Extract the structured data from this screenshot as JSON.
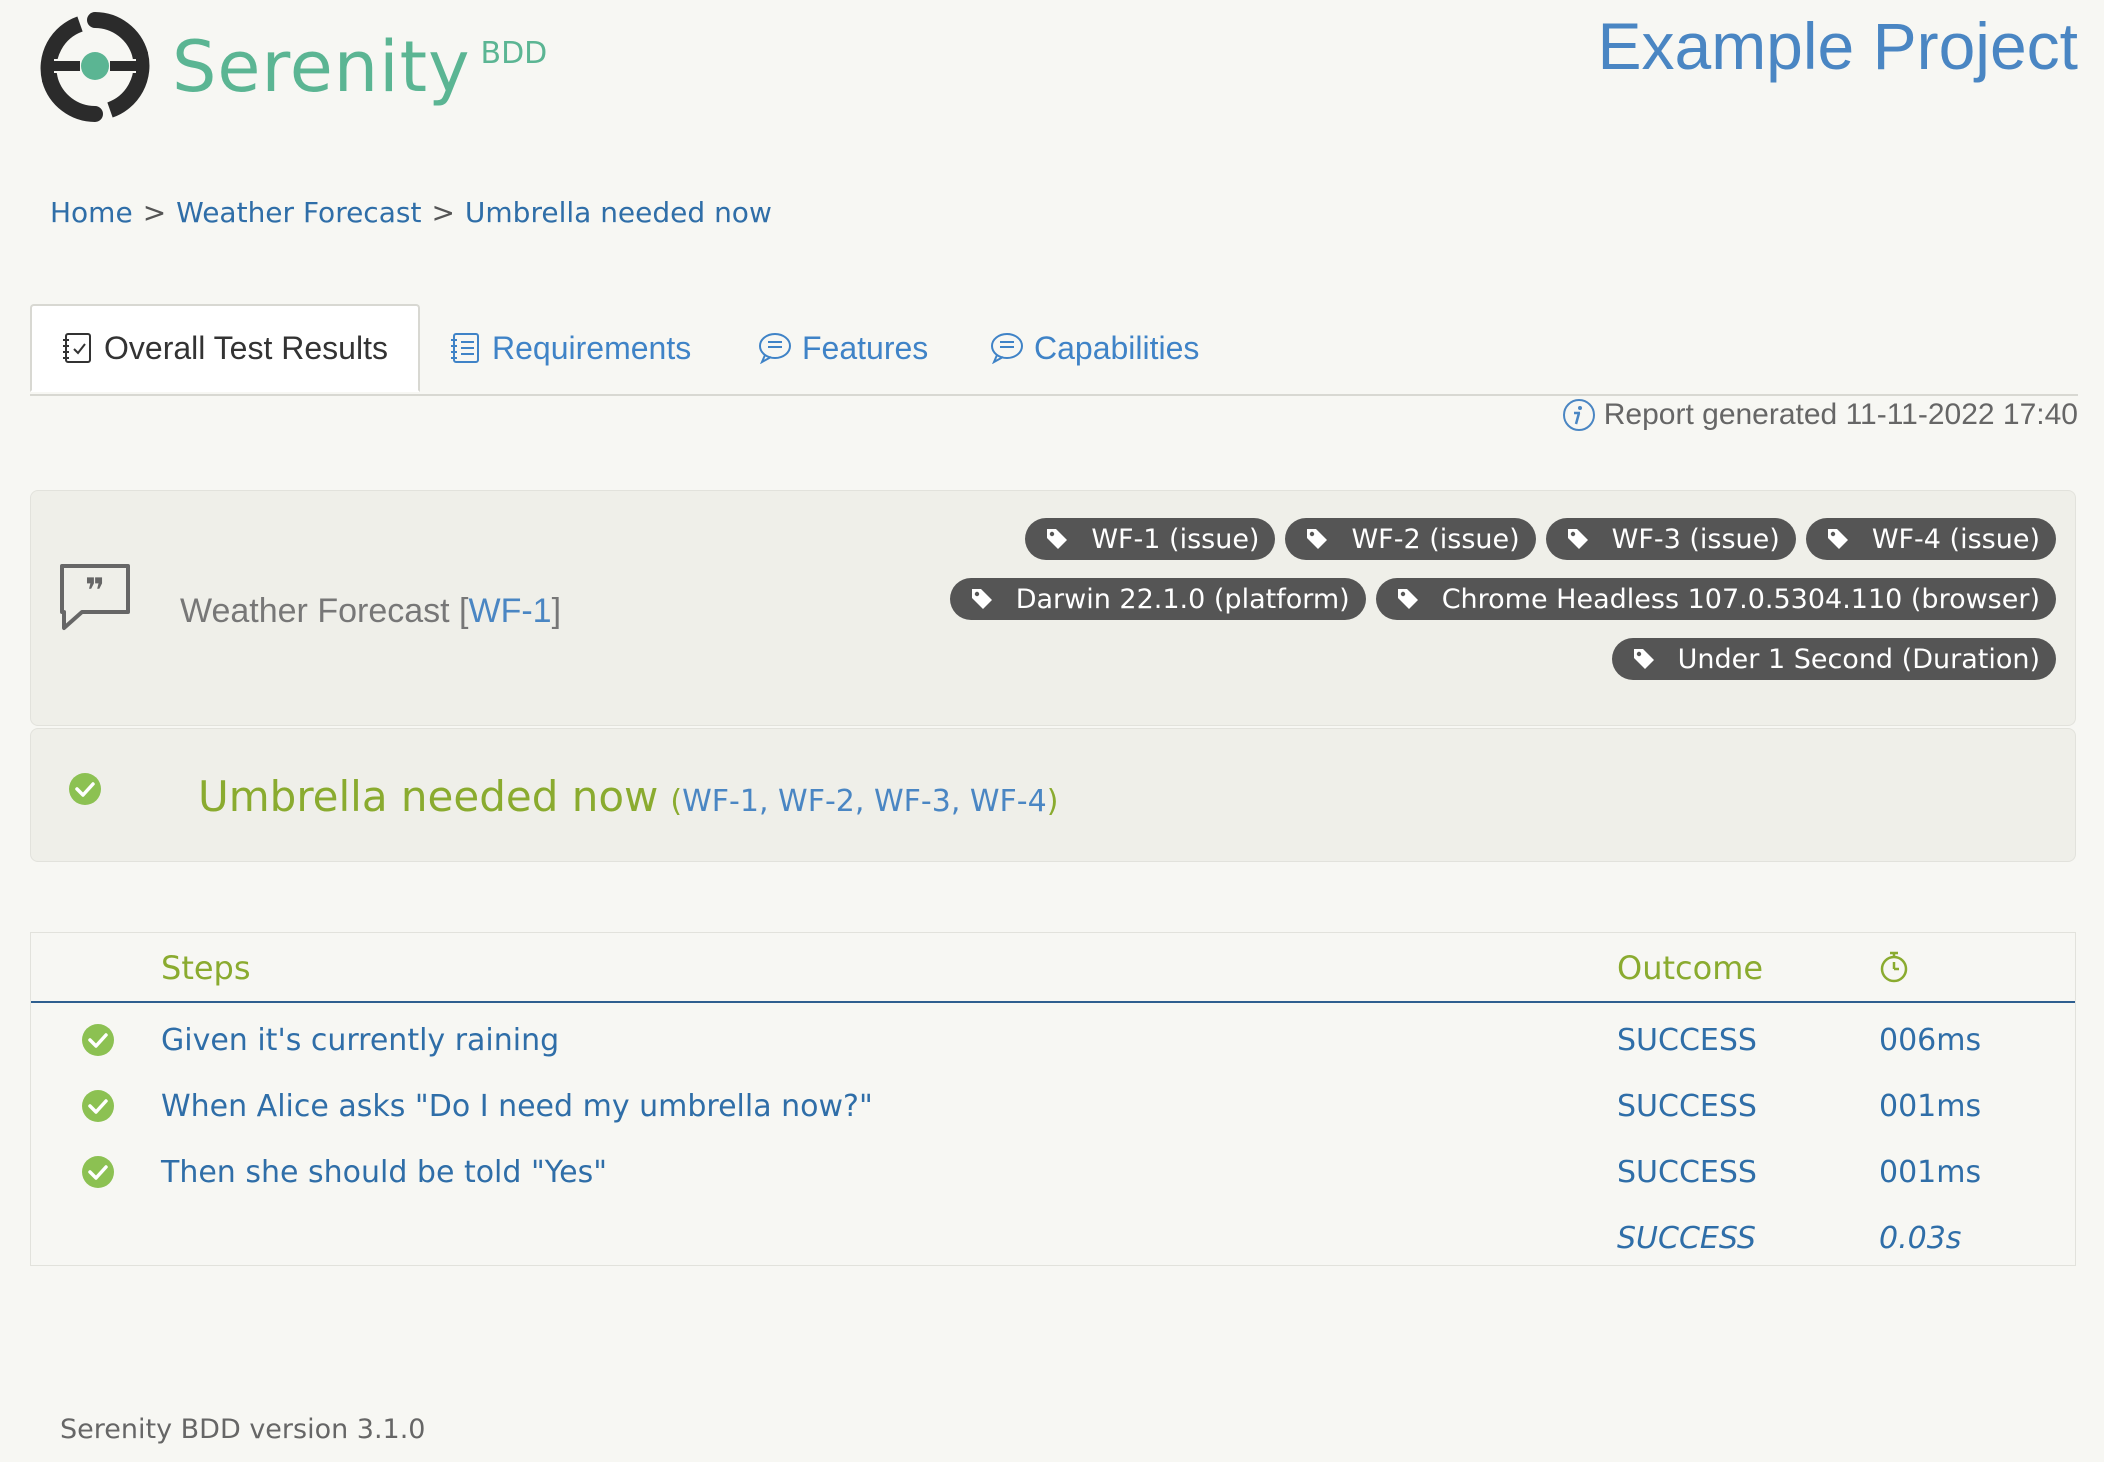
{
  "logo": {
    "word": "Serenity",
    "suffix": "BDD",
    "brand_color": "#5bb593",
    "dark_color": "#2b2b2b"
  },
  "project_title": "Example Project",
  "breadcrumb": {
    "items": [
      "Home",
      "Weather Forecast",
      "Umbrella needed now"
    ],
    "separator": ">"
  },
  "tabs": [
    {
      "label": "Overall Test Results",
      "icon": "checklist-icon",
      "active": true
    },
    {
      "label": "Requirements",
      "icon": "list-icon",
      "active": false
    },
    {
      "label": "Features",
      "icon": "chat-icon",
      "active": false
    },
    {
      "label": "Capabilities",
      "icon": "chat-icon",
      "active": false
    }
  ],
  "report": {
    "text": "Report generated 11-11-2022 17:40",
    "icon": "info-icon"
  },
  "feature": {
    "icon": "quote-bubble-icon",
    "title": "Weather Forecast",
    "issue_open": "[",
    "issue_link": "WF-1",
    "issue_close": "]",
    "tags_row1": [
      "WF-1 (issue)",
      "WF-2 (issue)",
      "WF-3 (issue)",
      "WF-4 (issue)"
    ],
    "tags_row2": [
      "Darwin 22.1.0 (platform)",
      "Chrome Headless 107.0.5304.110 (browser)"
    ],
    "tags_row3": [
      "Under 1 Second (Duration)"
    ]
  },
  "scenario": {
    "title": "Umbrella needed now",
    "issues_open": "(",
    "issues": [
      "WF-1",
      "WF-2",
      "WF-3",
      "WF-4"
    ],
    "issues_close": ")",
    "status_color": "#8cc152"
  },
  "steps": {
    "headers": {
      "steps": "Steps",
      "outcome": "Outcome",
      "duration_icon": "stopwatch-icon"
    },
    "rows": [
      {
        "text": "Given it's currently raining",
        "outcome": "SUCCESS",
        "duration": "006ms"
      },
      {
        "text": "When Alice asks \"Do I need my umbrella now?\"",
        "outcome": "SUCCESS",
        "duration": "001ms"
      },
      {
        "text": "Then she should be told \"Yes\"",
        "outcome": "SUCCESS",
        "duration": "001ms"
      }
    ],
    "total": {
      "outcome": "SUCCESS",
      "duration": "0.03s"
    }
  },
  "footer": {
    "version": "Serenity BDD version 3.1.0"
  }
}
